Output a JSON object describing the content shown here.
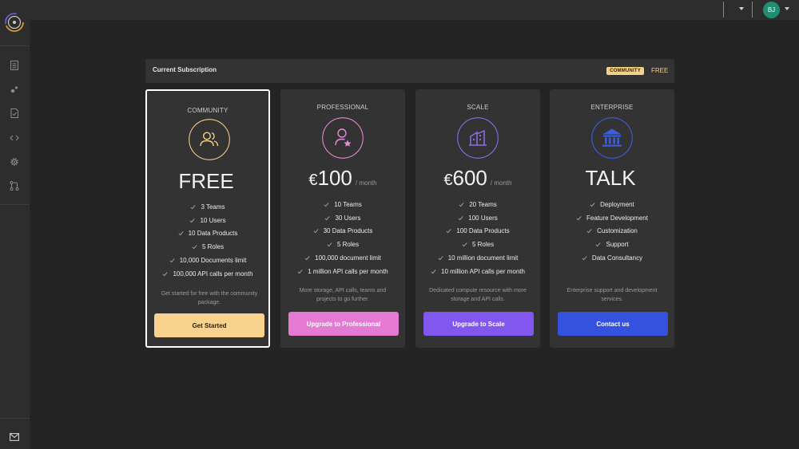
{
  "app": {
    "logo": "circular-rings-logo"
  },
  "topbar": {
    "avatar_initials": "BJ",
    "icons": [
      "caret-down-icon",
      "caret-down-icon"
    ]
  },
  "sidebar": {
    "items": [
      "document-icon",
      "dots-icon",
      "checklist-icon",
      "code-icon",
      "gear-icon",
      "merge-icon"
    ],
    "bottom": "mail-icon"
  },
  "subscription": {
    "label": "Current Subscription",
    "badge": "COMMUNITY",
    "plan": "FREE"
  },
  "plans": [
    {
      "tier": "COMMUNITY",
      "icon": "users-icon",
      "accent": "#f4d089",
      "price_currency": "",
      "price_value": "FREE",
      "price_period": "",
      "features": [
        "3 Teams",
        "10 Users",
        "10 Data Products",
        "5 Roles",
        "10,000 Documents limit",
        "100,000 API calls per month"
      ],
      "description": "Get started for free with the community package.",
      "button": "Get Started",
      "button_color": "#f9d28e",
      "button_text_color": "#2c2206"
    },
    {
      "tier": "PROFESSIONAL",
      "icon": "user-star-icon",
      "accent": "#e88ad7",
      "price_currency": "€",
      "price_value": "100",
      "price_period": "/ month",
      "features": [
        "10 Teams",
        "30 Users",
        "30 Data Products",
        "5 Roles",
        "100,000 document limit",
        "1 million API calls per month"
      ],
      "description": "More storage, API calls, teams and projects to go further.",
      "button": "Upgrade to Professional",
      "button_color": "#e57ad4",
      "button_text_color": "#ffffff"
    },
    {
      "tier": "SCALE",
      "icon": "building-icon",
      "accent": "#8f6cf2",
      "price_currency": "€",
      "price_value": "600",
      "price_period": "/ month",
      "features": [
        "20 Teams",
        "100 Users",
        "100 Data Products",
        "5 Roles",
        "10 million document limit",
        "10 million API calls per month"
      ],
      "description": "Dedicated compute resource with more storage and API calls.",
      "button": "Upgrade to Scale",
      "button_color": "#8157f0",
      "button_text_color": "#ffffff"
    },
    {
      "tier": "ENTERPRISE",
      "icon": "bank-icon",
      "accent": "#3a5ee0",
      "price_currency": "",
      "price_value": "TALK",
      "price_period": "",
      "features": [
        "Deployment",
        "Feature Development",
        "Customization",
        "Support",
        "Data Consultancy"
      ],
      "description": "Enterprise support and development services.",
      "button": "Contact us",
      "button_color": "#3552df",
      "button_text_color": "#ffffff"
    }
  ]
}
